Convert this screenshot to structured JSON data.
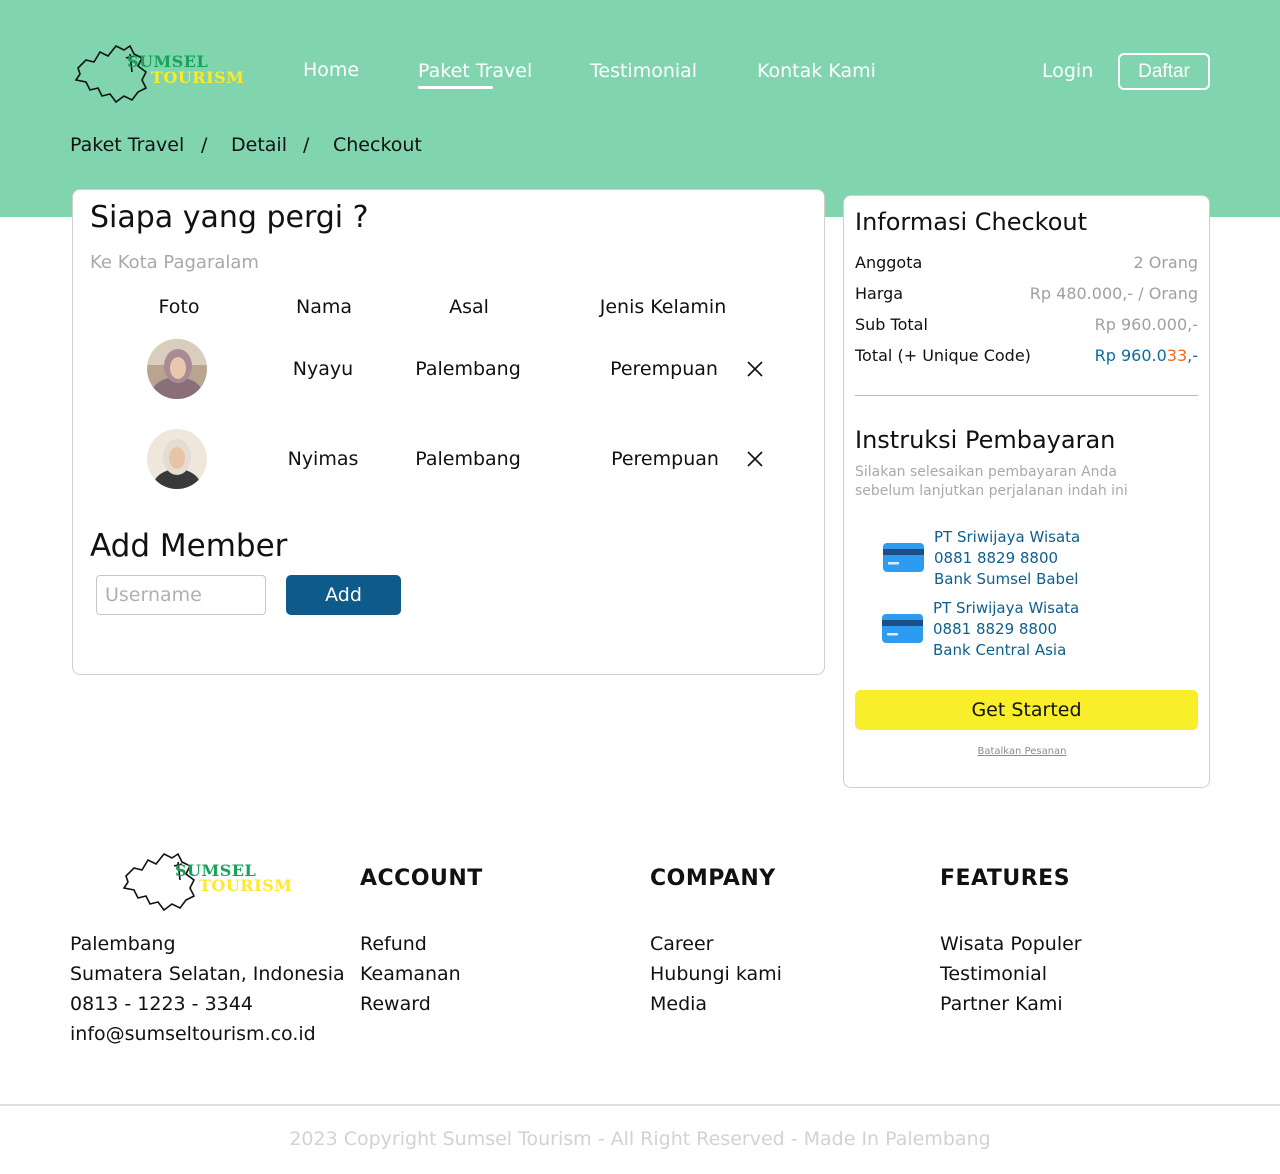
{
  "brand": {
    "line1": "SUMSEL",
    "line2": "TOURISM"
  },
  "nav": {
    "items": [
      {
        "label": "Home"
      },
      {
        "label": "Paket Travel"
      },
      {
        "label": "Testimonial"
      },
      {
        "label": "Kontak Kami"
      }
    ],
    "active_index": 1,
    "login": "Login",
    "register": "Daftar"
  },
  "breadcrumb": {
    "items": [
      "Paket Travel",
      "Detail",
      "Checkout"
    ],
    "separator": "/"
  },
  "members_card": {
    "title": "Siapa yang pergi ?",
    "subtitle": "Ke Kota Pagaralam",
    "columns": [
      "Foto",
      "Nama",
      "Asal",
      "Jenis Kelamin"
    ],
    "rows": [
      {
        "name": "Nyayu",
        "origin": "Palembang",
        "gender": "Perempuan"
      },
      {
        "name": "Nyimas",
        "origin": "Palembang",
        "gender": "Perempuan"
      }
    ],
    "add_title": "Add Member",
    "username_placeholder": "Username",
    "add_label": "Add"
  },
  "checkout": {
    "title": "Informasi Checkout",
    "rows": [
      {
        "label": "Anggota",
        "value": "2 Orang"
      },
      {
        "label": "Harga",
        "value": "Rp 480.000,- / Orang"
      },
      {
        "label": "Sub Total",
        "value": "Rp 960.000,-"
      }
    ],
    "total": {
      "label": "Total (+ Unique Code)",
      "value_main": "Rp 960.0",
      "value_code": "33",
      "value_end": ",-"
    },
    "payment_title": "Instruksi Pembayaran",
    "payment_desc": "Silakan selesaikan pembayaran Anda sebelum lanjutkan perjalanan indah ini",
    "banks": [
      {
        "holder": "PT Sriwijaya Wisata",
        "account": "0881 8829 8800",
        "bank": "Bank Sumsel Babel"
      },
      {
        "holder": "PT Sriwijaya Wisata",
        "account": "0881 8829 8800",
        "bank": "Bank Central Asia"
      }
    ],
    "cta": "Get Started",
    "cancel": "Batalkan Pesanan"
  },
  "footer": {
    "address": [
      "Palembang",
      "Sumatera Selatan, Indonesia",
      "0813 - 1223 - 3344",
      "info@sumseltourism.co.id"
    ],
    "columns": [
      {
        "heading": "ACCOUNT",
        "links": [
          "Refund",
          "Keamanan",
          "Reward"
        ]
      },
      {
        "heading": "COMPANY",
        "links": [
          "Career",
          "Hubungi kami",
          "Media"
        ]
      },
      {
        "heading": "FEATURES",
        "links": [
          "Wisata Populer",
          "Testimonial",
          "Partner Kami"
        ]
      }
    ],
    "copyright": "2023 Copyright Sumsel Tourism - All Right Reserved - Made In Palembang"
  },
  "colors": {
    "hero": "#80d4ae",
    "primary_button": "#0e5a8a",
    "cta": "#f8ee2a",
    "brand_green": "#17a35a",
    "brand_yellow": "#ffe927",
    "link_blue": "#0e6b9a",
    "unique_code": "#f26b1d"
  }
}
